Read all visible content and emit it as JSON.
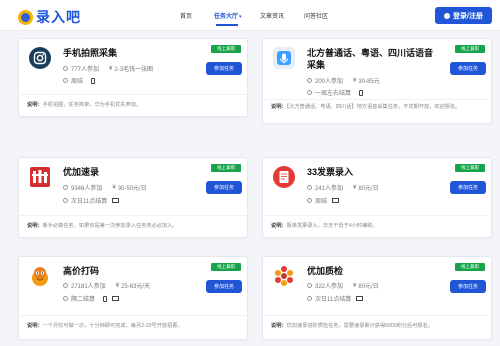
{
  "header": {
    "logo_text": "录入吧",
    "nav": [
      {
        "label": "首页"
      },
      {
        "label": "任务大厅"
      },
      {
        "label": "文章资讯"
      },
      {
        "label": "问答社区"
      }
    ],
    "nav_active_caret": "▾",
    "login_label": "登录/注册"
  },
  "tasks": [
    {
      "title": "手机拍照采集",
      "badge": "线上兼职",
      "join": "参加任务",
      "participants": "777人参加",
      "price": "2-3毛钱一张图",
      "settle": "周结",
      "desc_label": "说明：",
      "desc": "手机拍图，任务简单，华为手机优先参加。"
    },
    {
      "title": "北方普通话、粤语、四川话语音采集",
      "badge": "线上兼职",
      "join": "参加任务",
      "participants": "200人参加",
      "price": "30-85元",
      "settle": "一周左右结算",
      "desc_label": "说明：",
      "desc": "【北方普通话、粤语、四川话】地方语音采集任务，不定期开放，欢迎报名。"
    },
    {
      "title": "优加速录",
      "badge": "线上兼职",
      "join": "参加任务",
      "participants": "9346人参加",
      "price": "30-50元/日",
      "settle": "次日11点结算",
      "desc_label": "说明：",
      "desc": "新手必做任务，如果你是第一次参加录入任务务必必加入。"
    },
    {
      "title": "33发票录入",
      "badge": "线上兼职",
      "join": "参加任务",
      "participants": "241人参加",
      "price": "80元/日",
      "settle": "周结",
      "desc_label": "说明：",
      "desc": "瓶单发票录入，日天干低于4小时兼职。"
    },
    {
      "title": "高价打码",
      "badge": "线上兼职",
      "join": "参加任务",
      "participants": "27181人参加",
      "price": "25-63元/天",
      "settle": "隔二结算",
      "desc_label": "说明：",
      "desc": "一个月仅可做一次，十分钟即可完成，每月2-20号开放招募。"
    },
    {
      "title": "优加质检",
      "badge": "线上兼职",
      "join": "参加任务",
      "participants": "322人参加",
      "price": "80元/日",
      "settle": "次日11点结算",
      "desc_label": "说明：",
      "desc": "优加速录进阶质检任务，需要速录累计获得5000积分后可报名。"
    }
  ],
  "colors": {
    "accent": "#1f55d6",
    "badge": "#16a34a"
  }
}
